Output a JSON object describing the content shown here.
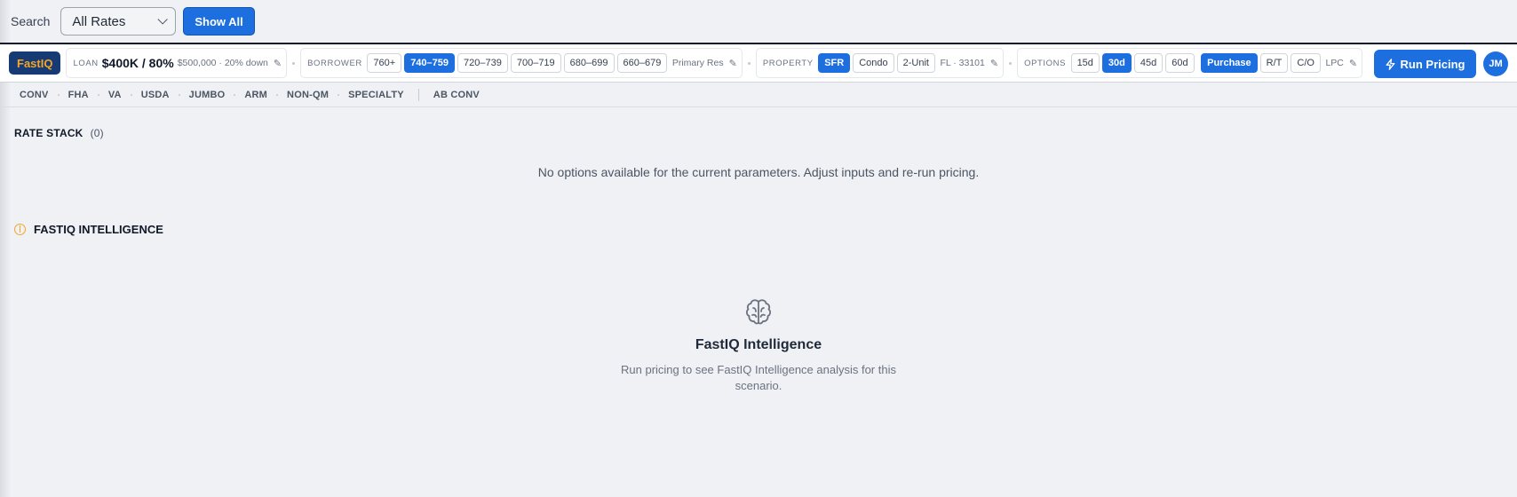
{
  "search": {
    "label": "Search",
    "select_value": "All Rates",
    "show_all_label": "Show All"
  },
  "toolbar": {
    "brand": "FastIQ",
    "loan": {
      "label": "LOAN",
      "main": "$400K / 80%",
      "detail": "$500,000 · 20% down"
    },
    "borrower": {
      "label": "BORROWER",
      "chips": [
        "760+",
        "740–759",
        "720–739",
        "700–719",
        "680–699",
        "660–679"
      ],
      "active": "740–759",
      "occupancy": "Primary Res"
    },
    "property": {
      "label": "PROPERTY",
      "chips": [
        "SFR",
        "Condo",
        "2-Unit"
      ],
      "active": "SFR",
      "location": "FL · 33101"
    },
    "options": {
      "label": "OPTIONS",
      "lock_chips": [
        "15d",
        "30d",
        "45d",
        "60d"
      ],
      "lock_active": "30d",
      "purpose_chips": [
        "Purchase",
        "R/T",
        "C/O"
      ],
      "purpose_active": "Purchase",
      "comp": "LPC"
    },
    "run_label": "Run Pricing",
    "avatar_initials": "JM"
  },
  "programs": {
    "tabs": [
      "CONV",
      "FHA",
      "VA",
      "USDA",
      "JUMBO",
      "ARM",
      "NON-QM",
      "SPECIALTY"
    ],
    "extra_tab": "AB CONV"
  },
  "rate_stack": {
    "title": "RATE STACK",
    "count": "(0)",
    "empty_message": "No options available for the current parameters. Adjust inputs and re-run pricing."
  },
  "intelligence": {
    "title": "FASTIQ INTELLIGENCE",
    "heading": "FastIQ Intelligence",
    "subtext": "Run pricing to see FastIQ Intelligence analysis for this scenario."
  },
  "colors": {
    "accent": "#1d6fe0",
    "brand_bg": "#163a73",
    "brand_text": "#f5a524",
    "page_bg": "#eff1f5"
  },
  "icons": [
    "chevron-down-icon",
    "pencil-icon",
    "bolt-icon",
    "brain-icon"
  ]
}
